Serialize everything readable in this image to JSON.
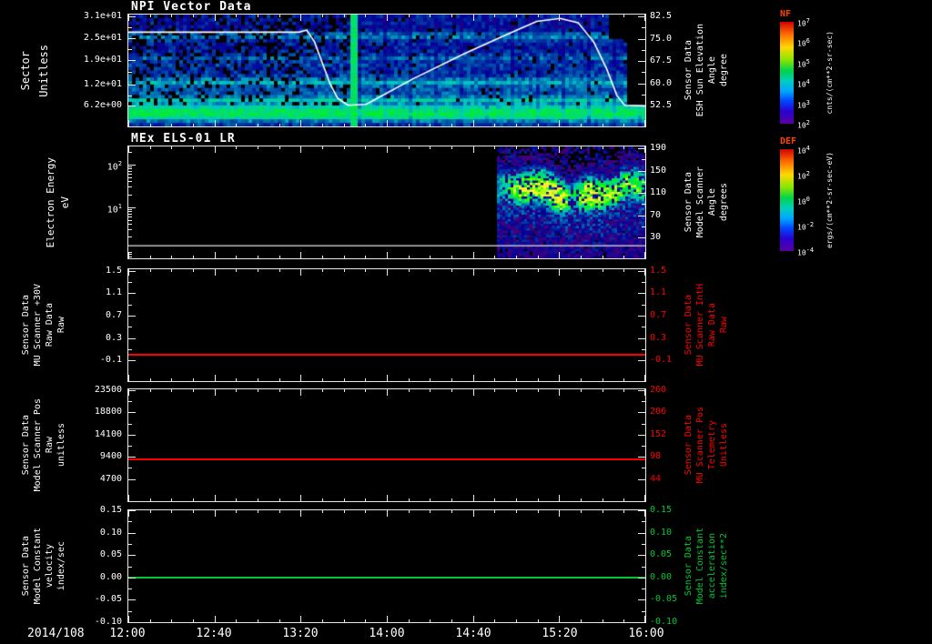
{
  "page": {
    "background": "#000000",
    "x_axis": {
      "date_label": "2014/108",
      "tick_labels": [
        "12:00",
        "12:40",
        "13:20",
        "14:00",
        "14:40",
        "15:20",
        "16:00"
      ],
      "minor_per_major": 4
    }
  },
  "colorbars": [
    {
      "name": "NF",
      "title_color": "#ff4400",
      "unit": "cnts/(cm**2-sr-sec)",
      "ticks": [
        {
          "base": "10",
          "exp": "7"
        },
        {
          "base": "10",
          "exp": "6"
        },
        {
          "base": "10",
          "exp": "5"
        },
        {
          "base": "10",
          "exp": "4"
        },
        {
          "base": "10",
          "exp": "3"
        },
        {
          "base": "10",
          "exp": "2"
        }
      ]
    },
    {
      "name": "DEF",
      "title_color": "#ff4400",
      "unit": "ergs/(cm**2-sr-sec-eV)",
      "ticks": [
        {
          "base": "10",
          "exp": "4"
        },
        {
          "base": "10",
          "exp": "2"
        },
        {
          "base": "10",
          "exp": "0"
        },
        {
          "base": "10",
          "exp": "-2"
        },
        {
          "base": "10",
          "exp": "-4"
        }
      ]
    }
  ],
  "chart_data": [
    {
      "type": "heatmap",
      "title": "NPI Vector Data",
      "time_range": [
        "12:00",
        "16:00"
      ],
      "left_axis": {
        "label_lines": [
          "Sector",
          "Unitless"
        ],
        "range": [
          0.45,
          31.5
        ],
        "ticks": [
          {
            "v": 31,
            "label": "3.1e+01"
          },
          {
            "v": 25,
            "label": "2.5e+01"
          },
          {
            "v": 19,
            "label": "1.9e+01"
          },
          {
            "v": 12,
            "label": "1.2e+01"
          },
          {
            "v": 6.2,
            "label": "6.2e+00"
          }
        ]
      },
      "right_axis": {
        "label_lines": [
          "Sensor Data",
          "ESH Sun Elevation",
          "Angle",
          "degree"
        ],
        "color": "#ffffff",
        "range": [
          45.6,
          83.1
        ],
        "ticks": [
          {
            "v": 82.5,
            "label": "82.5"
          },
          {
            "v": 75.0,
            "label": "75.0"
          },
          {
            "v": 67.5,
            "label": "67.5"
          },
          {
            "v": 60.0,
            "label": "60.0"
          },
          {
            "v": 52.5,
            "label": "52.5"
          }
        ]
      },
      "overlay_line": {
        "color": "#ffffff",
        "axis": "right",
        "points": [
          [
            0.0,
            77.2
          ],
          [
            0.33,
            77.2
          ],
          [
            0.345,
            77.9
          ],
          [
            0.36,
            74.0
          ],
          [
            0.375,
            67.0
          ],
          [
            0.39,
            60.0
          ],
          [
            0.405,
            55.0
          ],
          [
            0.425,
            52.7
          ],
          [
            0.46,
            53.0
          ],
          [
            0.55,
            61.5
          ],
          [
            0.65,
            70.0
          ],
          [
            0.72,
            75.5
          ],
          [
            0.79,
            80.8
          ],
          [
            0.835,
            81.8
          ],
          [
            0.87,
            80.4
          ],
          [
            0.9,
            74.0
          ],
          [
            0.925,
            65.0
          ],
          [
            0.945,
            56.0
          ],
          [
            0.96,
            52.7
          ],
          [
            1.0,
            52.5
          ]
        ]
      },
      "heatmap": {
        "style": "npi",
        "rows": 32,
        "row_profile": [
          0.26,
          0.34,
          0.5,
          0.58,
          0.55,
          0.46,
          0.38,
          0.44,
          0.34,
          0.3,
          0.29,
          0.32,
          0.4,
          0.33,
          0.27,
          0.25,
          0.24,
          0.26,
          0.25,
          0.31,
          0.26,
          0.23,
          0.21,
          0.23,
          0.25,
          0.34,
          0.29,
          0.21,
          0.19,
          0.21,
          0.2,
          0.22
        ],
        "left_dark_until": 0.43,
        "bright_col_frac": 0.435
      },
      "colorbar": 0
    },
    {
      "type": "heatmap",
      "title": "MEx ELS-01 LR",
      "left_axis": {
        "label_lines": [
          "Electron Energy",
          "eV"
        ],
        "log": true,
        "range": [
          -0.2,
          2.42
        ],
        "ticks": [
          {
            "v": 2,
            "label": "10",
            "exp": "2"
          },
          {
            "v": 1,
            "label": "10",
            "exp": "1"
          }
        ]
      },
      "right_axis": {
        "label_lines": [
          "Sensor Data",
          "Model Scanner",
          "Angle",
          "degrees"
        ],
        "color": "#ffffff",
        "range": [
          -6.8,
          193.2
        ],
        "ticks": [
          {
            "v": 190,
            "label": "190"
          },
          {
            "v": 150,
            "label": "150"
          },
          {
            "v": 110,
            "label": "110"
          },
          {
            "v": 70,
            "label": "70"
          },
          {
            "v": 30,
            "label": "30"
          }
        ]
      },
      "heatmap": {
        "style": "els",
        "onset_frac": 0.708,
        "energy_log_range": [
          -0.2,
          2.42
        ],
        "band_center_log": 1.35,
        "band_sigma_log": 0.3,
        "sweep_line_log": 0.11,
        "bumps": [
          [
            0.708,
            0.35
          ],
          [
            0.75,
            0.8
          ],
          [
            0.79,
            0.9
          ],
          [
            0.83,
            1.0
          ],
          [
            0.855,
            0.5
          ],
          [
            0.885,
            0.95
          ],
          [
            0.93,
            0.75
          ],
          [
            1.0,
            0.7
          ]
        ]
      },
      "colorbar": 1
    },
    {
      "type": "line",
      "left_axis": {
        "label_lines": [
          "Sensor Data",
          "MU Scanner +30V",
          "Raw Data",
          "Raw"
        ],
        "range": [
          -0.47,
          1.53
        ],
        "ticks": [
          {
            "v": 1.5,
            "label": "1.5"
          },
          {
            "v": 1.1,
            "label": "1.1"
          },
          {
            "v": 0.7,
            "label": "0.7"
          },
          {
            "v": 0.3,
            "label": "0.3"
          },
          {
            "v": -0.1,
            "label": "-0.1"
          }
        ]
      },
      "right_axis": {
        "label_lines": [
          "Sensor Data",
          "MU Scanner IntH",
          "Raw Data",
          "Raw"
        ],
        "color": "#ff0000",
        "range": [
          -0.47,
          1.53
        ],
        "ticks": [
          {
            "v": 1.5,
            "label": "1.5"
          },
          {
            "v": 1.1,
            "label": "1.1"
          },
          {
            "v": 0.7,
            "label": "0.7"
          },
          {
            "v": 0.3,
            "label": "0.3"
          },
          {
            "v": -0.1,
            "label": "-0.1"
          }
        ]
      },
      "series": [
        {
          "name": "MU Scanner +30V Raw",
          "color": "#ff0000",
          "value": 0.0
        }
      ]
    },
    {
      "type": "line",
      "left_axis": {
        "label_lines": [
          "Sensor Data",
          "Model Scanner Pos",
          "Raw",
          "unitless"
        ],
        "range": [
          0,
          23700
        ],
        "ticks": [
          {
            "v": 23500,
            "label": "23500"
          },
          {
            "v": 18800,
            "label": "18800"
          },
          {
            "v": 14100,
            "label": "14100"
          },
          {
            "v": 9400,
            "label": "9400"
          },
          {
            "v": 4700,
            "label": "4700"
          }
        ]
      },
      "right_axis": {
        "label_lines": [
          "Sensor Data",
          "MU Scanner Pos",
          "Telemetry",
          "Unitless"
        ],
        "color": "#ff0000",
        "range": [
          -9.9,
          262.3
        ],
        "ticks": [
          {
            "v": 260,
            "label": "260"
          },
          {
            "v": 206,
            "label": "206"
          },
          {
            "v": 152,
            "label": "152"
          },
          {
            "v": 98,
            "label": "98"
          },
          {
            "v": 44,
            "label": "44"
          }
        ]
      },
      "series": [
        {
          "name": "Model Scanner Pos Raw",
          "color": "#ff0000",
          "value": 8850
        }
      ]
    },
    {
      "type": "line",
      "left_axis": {
        "label_lines": [
          "Sensor Data",
          "Model Constant",
          "velocity",
          "index/sec"
        ],
        "range": [
          -0.1,
          0.15
        ],
        "ticks": [
          {
            "v": 0.15,
            "label": "0.15"
          },
          {
            "v": 0.1,
            "label": "0.10"
          },
          {
            "v": 0.05,
            "label": "0.05"
          },
          {
            "v": 0.0,
            "label": "0.00"
          },
          {
            "v": -0.05,
            "label": "-0.05"
          },
          {
            "v": -0.1,
            "label": "-0.10"
          }
        ]
      },
      "right_axis": {
        "label_lines": [
          "Sensor Data",
          "Model Constant",
          "acceleration",
          "index/sec**2"
        ],
        "color": "#00c832",
        "range": [
          -0.1,
          0.15
        ],
        "ticks": [
          {
            "v": 0.15,
            "label": "0.15"
          },
          {
            "v": 0.1,
            "label": "0.10"
          },
          {
            "v": 0.05,
            "label": "0.05"
          },
          {
            "v": 0.0,
            "label": "0.00"
          },
          {
            "v": -0.05,
            "label": "-0.05"
          },
          {
            "v": -0.1,
            "label": "-0.10"
          }
        ]
      },
      "series": [
        {
          "name": "Model Constant velocity",
          "color": "#00c832",
          "value": 0.0
        }
      ]
    }
  ]
}
